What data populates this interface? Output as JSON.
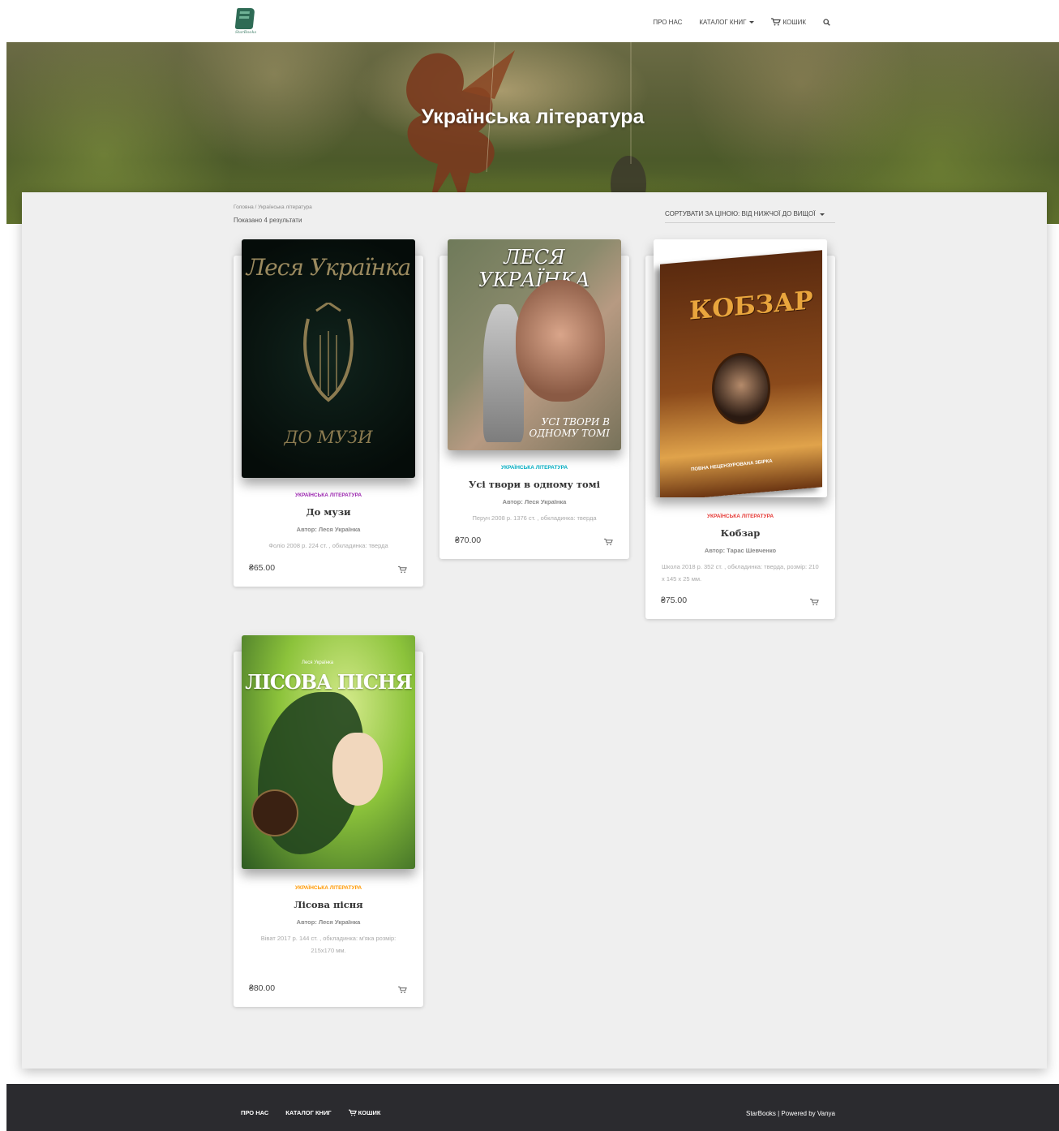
{
  "header": {
    "logo_text": "StarBooks",
    "nav": [
      {
        "label": "Про нас"
      },
      {
        "label": "Каталог книг"
      },
      {
        "label": "Кошик"
      }
    ]
  },
  "hero": {
    "title": "Українська література"
  },
  "shop": {
    "breadcrumb": "Головна / Українська література",
    "result_count": "Показано 4 результати",
    "sort_label": "Сортувати за ціною: від нижчої до вищої"
  },
  "products": [
    {
      "category": "Українська література",
      "category_color": "#9c27b0",
      "title": "До музи",
      "author": "Автор: Леся Українка",
      "description": "Фоліо 2008 р. 224 ст. , обкладинка: тверда",
      "price": "₴65.00",
      "cover": {
        "title": "Леся Українка",
        "subtitle": "ДО МУЗИ"
      }
    },
    {
      "category": "Українська література",
      "category_color": "#00acc1",
      "title": "Усі твори в одному томі",
      "author": "Автор: Леся Українка",
      "description": "Перун 2008 р. 1376 ст. , обкладинка: тверда",
      "price": "₴70.00",
      "cover": {
        "title": "ЛЕСЯ УКРАЇНКА",
        "subtitle": "УСІ ТВОРИ В ОДНОМУ ТОМІ"
      }
    },
    {
      "category": "Українська література",
      "category_color": "#e53935",
      "title": "Кобзар",
      "author": "Автор: Тарас Шевченко",
      "description": "Школа 2018 р. 352 ст. , обкладинка: тверда, розмір: 210 x 145 x 25 мм.",
      "price": "₴75.00",
      "cover": {
        "title": "КОБЗАР",
        "subtitle": "ПОВНА НЕЦЕНЗУРОВАНА ЗБІРКА"
      }
    },
    {
      "category": "Українська література",
      "category_color": "#ff9800",
      "title": "Лісова пісня",
      "author": "Автор: Леся Українка",
      "description": "Віват 2017 р. 144 ст. , обкладинка: м'яка розмір: 215х170 мм.",
      "price": "₴80.00",
      "cover": {
        "pretitle": "Леся Українка",
        "title": "ЛІСОВА ПІСНЯ"
      }
    }
  ],
  "footer": {
    "nav": [
      {
        "label": "Про нас"
      },
      {
        "label": "Каталог книг"
      },
      {
        "label": "Кошик"
      }
    ],
    "credit": "StarBooks | Powered by Vanya"
  },
  "icons": {
    "cart": "cart-icon",
    "search": "search-icon",
    "caret": "chevron-down-icon"
  }
}
